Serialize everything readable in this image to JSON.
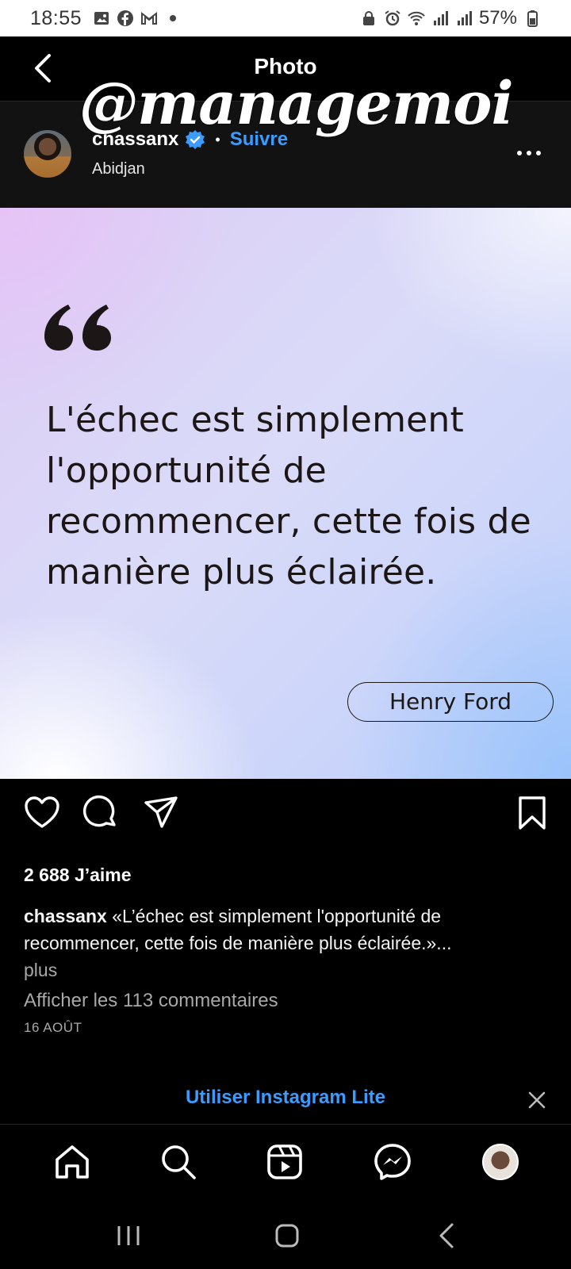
{
  "status_bar": {
    "time": "18:55",
    "battery": "57%",
    "left_icons": [
      "gallery-icon",
      "facebook-icon",
      "gmail-icon",
      "dot-icon"
    ],
    "right_icons": [
      "lock-icon",
      "alarm-icon",
      "wifi-icon",
      "signal-icon",
      "signal-icon",
      "battery-icon"
    ]
  },
  "header": {
    "title": "Photo"
  },
  "watermark": "@managemoi",
  "post": {
    "username": "chassanx",
    "follow_label": "Suivre",
    "location": "Abidjan",
    "quote": "L'échec est simplement l'opportunité de recommencer, cette fois de manière plus éclairée.",
    "author": "Henry Ford",
    "likes": "2 688 J’aime",
    "caption_user": "chassanx",
    "caption_text": "«L’échec est simplement l'opportunité de recommencer, cette fois de manière plus éclairée.»...",
    "caption_more": "plus",
    "comments_link": "Afficher les 113 commentaires",
    "date": "16 AOÛT"
  },
  "banner": {
    "lite_label": "Utiliser Instagram Lite"
  },
  "colors": {
    "accent": "#3b9cff",
    "background": "#000000",
    "header_bg": "#121212"
  }
}
